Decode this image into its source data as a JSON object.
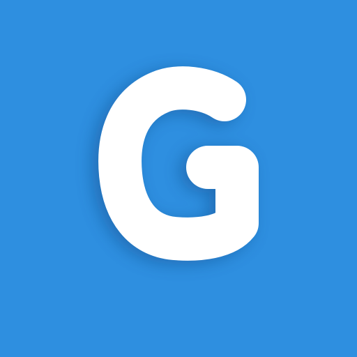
{
  "app_icon": {
    "logo_letter": "G",
    "icon_name": "g-letter-logo-icon",
    "colors": {
      "background": "#2E8FE0",
      "glyph": "#FFFFFF",
      "shadow": "#0A3E78"
    }
  }
}
